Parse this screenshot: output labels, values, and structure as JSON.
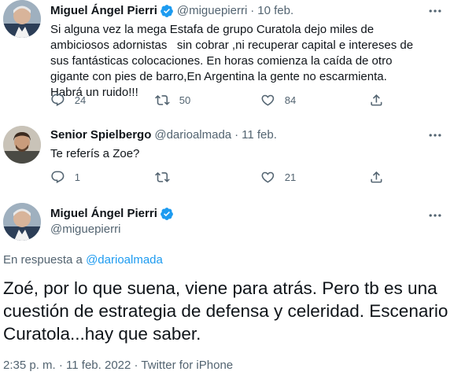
{
  "tweets": [
    {
      "name": "Miguel Ángel Pierri",
      "handle": "@miguepierri",
      "date": "10 feb.",
      "text": "Si alguna vez la mega Estafa de grupo Curatola dejo miles de ambiciosos adornistas   sin cobrar ,ni recuperar capital e intereses de sus fantásticas colocaciones. En horas comienza la caída de otro gigante con pies de barro,En Argentina la gente no escarmienta. Habrá un ruido!!!",
      "replies": "24",
      "retweets": "50",
      "likes": "84",
      "verified": true
    },
    {
      "name": "Senior Spielbergo",
      "handle": "@darioalmada",
      "date": "11 feb.",
      "text": "Te referís a Zoe?",
      "replies": "1",
      "retweets": "",
      "likes": "21",
      "verified": false
    }
  ],
  "main": {
    "name": "Miguel Ángel Pierri",
    "handle": "@miguepierri",
    "reply_prefix": "En respuesta a",
    "reply_handle": "@darioalmada",
    "text": "Zoé, por lo que suena, viene para atrás. Pero tb es una cuestión de estrategia de defensa y celeridad. Escenario Curatola...hay que saber.",
    "time": "2:35 p. m.",
    "date": "11 feb. 2022",
    "source": "Twitter for iPhone",
    "sep": "·"
  },
  "colors": {
    "verified": "#1d9bf0",
    "link": "#1d9bf0",
    "secondary_text": "#536471"
  },
  "icons": [
    "more-icon",
    "reply-icon",
    "retweet-icon",
    "like-icon",
    "share-icon",
    "verified-badge-icon"
  ]
}
